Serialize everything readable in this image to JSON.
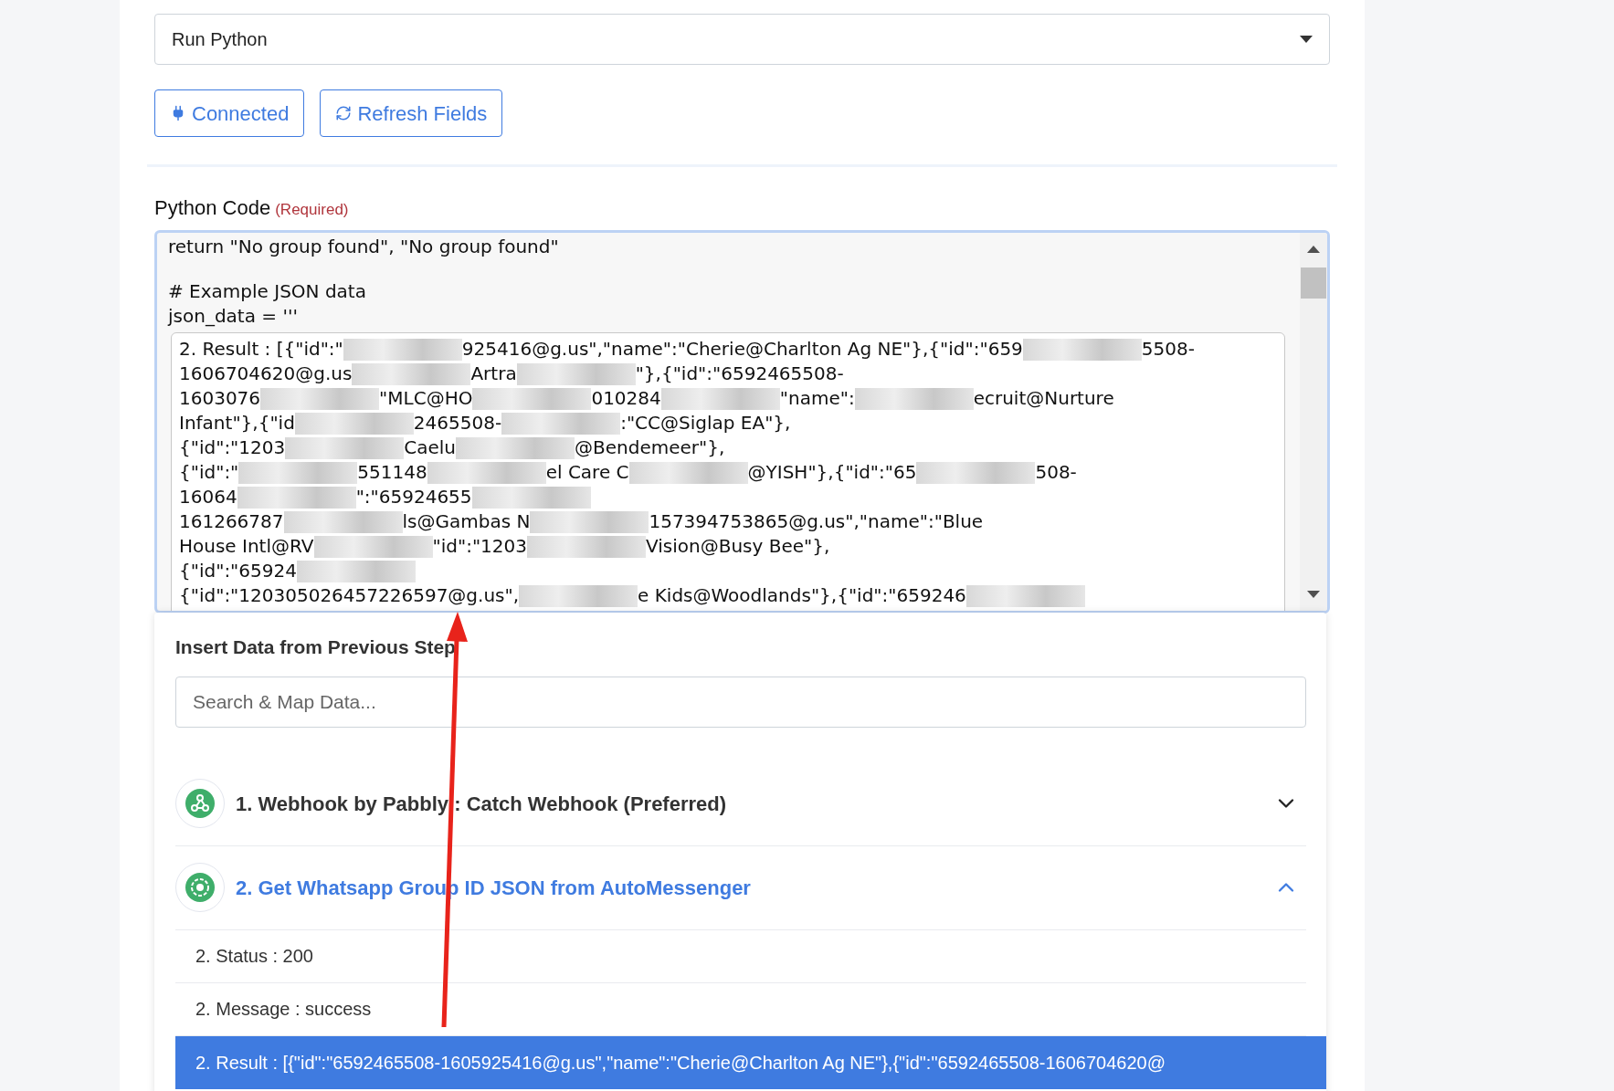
{
  "action_select": {
    "value": "Run Python"
  },
  "buttons": [
    {
      "kind": "connect",
      "label": "Connected"
    },
    {
      "kind": "refresh",
      "label": "Refresh Fields"
    }
  ],
  "code_field": {
    "label": "Python Code",
    "required_note": "(Required)",
    "lines": [
      "return \"No group found\", \"No group found\"",
      "# Example JSON data",
      "json_data = '''"
    ],
    "result_lines": [
      [
        {
          "kind": "text",
          "text": "2. Result : [{\"id\":\""
        },
        {
          "kind": "redacted"
        },
        {
          "kind": "text",
          "text": "925416@g.us\",\"name\":\"Cherie@Charlton Ag NE\"},{\"id\":\"659"
        },
        {
          "kind": "redacted"
        },
        {
          "kind": "text",
          "text": "5508-"
        }
      ],
      [
        {
          "kind": "text",
          "text": "1606704620@g.us"
        },
        {
          "kind": "redacted"
        },
        {
          "kind": "text",
          "text": "Artra"
        },
        {
          "kind": "redacted"
        },
        {
          "kind": "text",
          "text": "\"},{\"id\":\"6592465508-"
        }
      ],
      [
        {
          "kind": "text",
          "text": "1603076"
        },
        {
          "kind": "redacted"
        },
        {
          "kind": "text",
          "text": "\"MLC@HO"
        },
        {
          "kind": "redacted"
        },
        {
          "kind": "text",
          "text": "010284"
        },
        {
          "kind": "redacted"
        },
        {
          "kind": "text",
          "text": "\"name\":"
        },
        {
          "kind": "redacted"
        },
        {
          "kind": "text",
          "text": "ecruit@Nurture"
        }
      ],
      [
        {
          "kind": "text",
          "text": "Infant\"},{\"id"
        },
        {
          "kind": "redacted"
        },
        {
          "kind": "text",
          "text": "2465508-"
        },
        {
          "kind": "redacted"
        },
        {
          "kind": "text",
          "text": ":\"CC@Siglap EA\"},"
        }
      ],
      [
        {
          "kind": "text",
          "text": "{\"id\":\"1203"
        },
        {
          "kind": "redacted"
        },
        {
          "kind": "text",
          "text": "Caelu"
        },
        {
          "kind": "redacted"
        },
        {
          "kind": "text",
          "text": "@Bendemeer\"},"
        }
      ],
      [
        {
          "kind": "text",
          "text": "{\"id\":\""
        },
        {
          "kind": "redacted"
        },
        {
          "kind": "text",
          "text": "551148"
        },
        {
          "kind": "redacted"
        },
        {
          "kind": "text",
          "text": "el Care C"
        },
        {
          "kind": "redacted"
        },
        {
          "kind": "text",
          "text": "@YISH\"},{\"id\":\"65"
        },
        {
          "kind": "redacted"
        },
        {
          "kind": "text",
          "text": "508-"
        }
      ],
      [
        {
          "kind": "text",
          "text": "16064"
        },
        {
          "kind": "redacted"
        },
        {
          "kind": "text",
          "text": "\":\"65924655"
        },
        {
          "kind": "redacted"
        }
      ],
      [
        {
          "kind": "text",
          "text": "161266787"
        },
        {
          "kind": "redacted"
        },
        {
          "kind": "text",
          "text": "ls@Gambas N"
        },
        {
          "kind": "redacted"
        },
        {
          "kind": "text",
          "text": "157394753865@g.us\",\"name\":\"Blue"
        }
      ],
      [
        {
          "kind": "text",
          "text": "House Intl@RV"
        },
        {
          "kind": "redacted"
        },
        {
          "kind": "text",
          "text": "\"id\":\"1203"
        },
        {
          "kind": "redacted"
        },
        {
          "kind": "text",
          "text": "Vision@Busy Bee\"},"
        }
      ],
      [
        {
          "kind": "text",
          "text": "{\"id\":\"65924"
        },
        {
          "kind": "redacted"
        }
      ],
      [
        {
          "kind": "text",
          "text": "{\"id\":\"120305026457226597@g.us\","
        },
        {
          "kind": "redacted"
        },
        {
          "kind": "text",
          "text": "e Kids@Woodlands\"},{\"id\":\"659246"
        },
        {
          "kind": "redacted"
        }
      ]
    ]
  },
  "insert_panel": {
    "title": "Insert Data from Previous Step",
    "search": {
      "placeholder": "Search & Map Data..."
    },
    "steps": [
      {
        "kind": "webhook",
        "title": "1. Webhook by Pabbly : Catch Webhook (Preferred)",
        "expanded": false
      },
      {
        "kind": "api",
        "title": "2. Get Whatsapp Group ID JSON from AutoMessenger",
        "expanded": true,
        "fields": [
          {
            "label": "2. Status : 200",
            "selected": false
          },
          {
            "label": "2. Message : success",
            "selected": false
          },
          {
            "label": "2. Result : [{\"id\":\"6592465508-1605925416@g.us\",\"name\":\"Cherie@Charlton Ag NE\"},{\"id\":\"6592465508-1606704620@",
            "selected": true
          }
        ]
      }
    ]
  }
}
